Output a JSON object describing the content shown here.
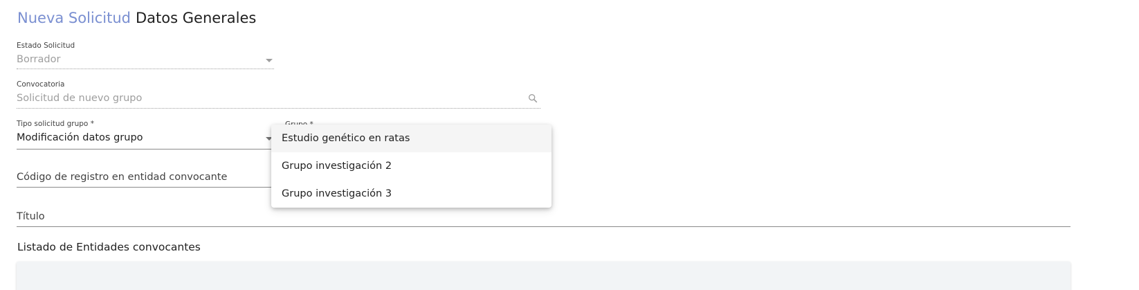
{
  "header": {
    "primary": "Nueva Solicitud",
    "secondary": "Datos Generales"
  },
  "form": {
    "estado": {
      "label": "Estado Solicitud",
      "value": "Borrador"
    },
    "convocatoria": {
      "label": "Convocatoria",
      "value": "Solicitud de nuevo grupo"
    },
    "tipo": {
      "label": "Tipo solicitud grupo *",
      "value": "Modificación datos grupo"
    },
    "grupo": {
      "label": "Grupo *"
    },
    "codigo": {
      "label": "Código de registro en entidad convocante"
    },
    "titulo": {
      "label": "Título"
    }
  },
  "dropdown": {
    "options": [
      "Estudio genético en ratas",
      "Grupo investigación 2",
      "Grupo investigación 3"
    ],
    "active_index": 0
  },
  "section": {
    "title": "Listado de Entidades convocantes"
  },
  "icons": {
    "search": "search-icon",
    "dropdown_arrow": "arrow-drop-down-icon"
  },
  "colors": {
    "accent": "#7a8fd1",
    "disabled_text": "#9e9e9e",
    "hover_bg": "#f5f5f5"
  }
}
